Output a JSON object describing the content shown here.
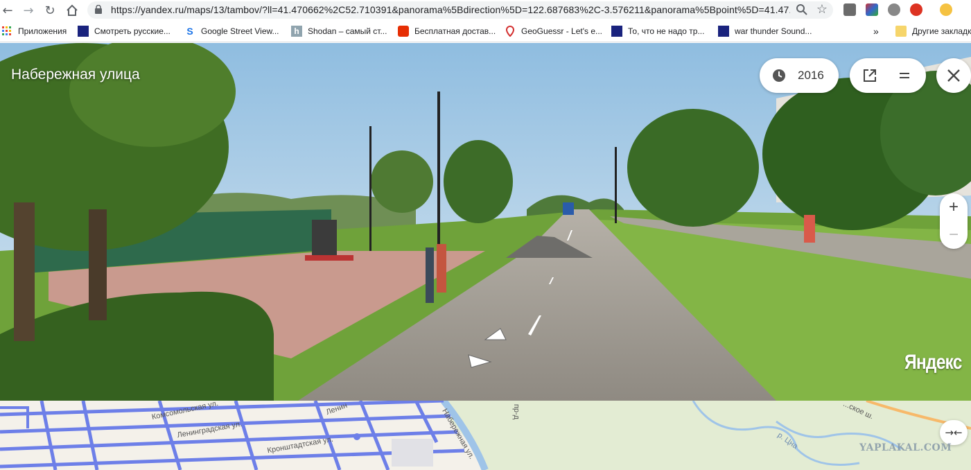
{
  "browser": {
    "url": "https://yandex.ru/maps/13/tambov/?ll=41.470662%2C52.710391&panorama%5Bdirection%5D=122.687683%2C-3.576211&panorama%5Bpoint%5D=41.47...",
    "nav_icons": [
      "back-icon",
      "forward-icon",
      "reload-icon",
      "home-icon"
    ],
    "bookmarks": [
      {
        "label": "Приложения",
        "icon": "apps-grid-icon"
      },
      {
        "label": "Смотреть русские...",
        "icon": "site-favicon"
      },
      {
        "label": "Google Street View...",
        "icon": "streetview-favicon"
      },
      {
        "label": "Shodan – самый ст...",
        "icon": "shodan-favicon"
      },
      {
        "label": "Бесплатная достав...",
        "icon": "aliexpress-favicon"
      },
      {
        "label": "GeoGuessr - Let's e...",
        "icon": "geoguessr-pin-favicon"
      },
      {
        "label": "То, что не надо тр...",
        "icon": "site-favicon"
      },
      {
        "label": "war thunder Sound...",
        "icon": "site-favicon"
      }
    ],
    "overflow_label": "»",
    "other_bookmarks": "Другие закладки"
  },
  "panorama": {
    "street_name": "Набережная улица",
    "year": "2016",
    "logo": "Яндекс",
    "zoom_in": "+",
    "zoom_out": "−"
  },
  "map": {
    "labels": [
      {
        "text": "Комсомольская ул."
      },
      {
        "text": "Ленинградская ул."
      },
      {
        "text": "Кронштадтская ул."
      },
      {
        "text": "Набережная ул."
      },
      {
        "text": "Ленин"
      },
      {
        "text": "р. Цна"
      },
      {
        "text": "пр-д"
      },
      {
        "text": "...ское ш."
      }
    ],
    "collapse_label": "→←",
    "watermark": "YAPLAKAL.COM"
  },
  "colors": {
    "sky": "#a9cbe6",
    "grass": "#7fb23f",
    "map_roads": "#6d7fe8",
    "map_bg": "#f4f1ea"
  }
}
